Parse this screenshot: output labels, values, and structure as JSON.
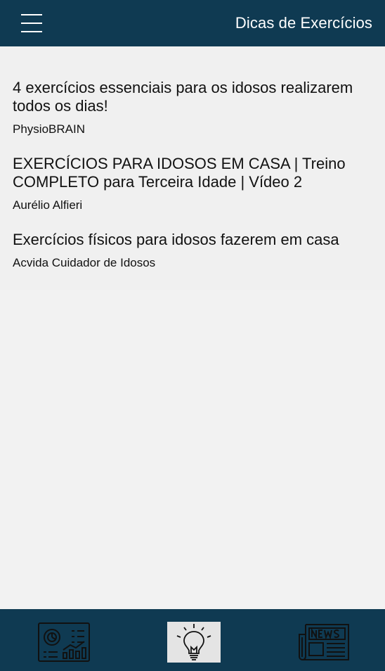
{
  "header": {
    "title": "Dicas de Exercícios",
    "menu_icon": "hamburger-menu-icon",
    "background": "#0f3a52"
  },
  "items": [
    {
      "title": "4 exercícios essenciais para os idosos realizarem todos os dias!",
      "author": "PhysioBRAIN"
    },
    {
      "title": "EXERCÍCIOS PARA IDOSOS EM CASA | Treino COMPLETO para Terceira Idade | Vídeo 2",
      "author": "Aurélio Alfieri"
    },
    {
      "title": "Exercícios físicos para idosos fazerem em casa",
      "author": "Acvida Cuidador de Idosos"
    }
  ],
  "bottom_nav": {
    "items": [
      {
        "icon": "dashboard-icon",
        "active": false
      },
      {
        "icon": "lightbulb-icon",
        "active": true
      },
      {
        "icon": "news-icon",
        "active": false
      }
    ]
  }
}
